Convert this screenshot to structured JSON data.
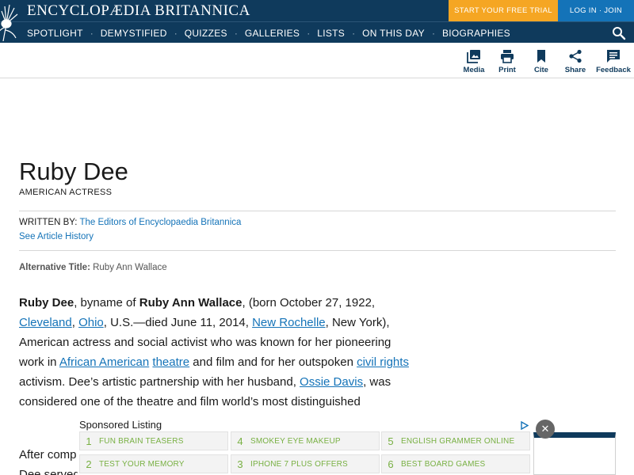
{
  "header": {
    "logo_text": "ENCYCLOPÆDIA BRITANNICA",
    "trial_button": "START YOUR FREE TRIAL",
    "login_button": "LOG IN · JOIN",
    "nav": [
      "SPOTLIGHT",
      "DEMYSTIFIED",
      "QUIZZES",
      "GALLERIES",
      "LISTS",
      "ON THIS DAY",
      "BIOGRAPHIES"
    ],
    "nav_separator": "·",
    "colors": {
      "navy": "#0f3a5c",
      "orange": "#f5a623",
      "blue": "#1473b8"
    }
  },
  "toolbar": {
    "media": "Media",
    "print": "Print",
    "cite": "Cite",
    "share": "Share",
    "feedback": "Feedback"
  },
  "article": {
    "title": "Ruby Dee",
    "subtitle": "AMERICAN ACTRESS",
    "written_by_label": "WRITTEN BY:",
    "author": "The Editors of Encyclopaedia Britannica",
    "history_link": "See Article History",
    "alt_title_label": "Alternative Title:",
    "alt_title_value": "Ruby Ann Wallace",
    "para1": {
      "name": "Ruby Dee",
      "t1": ", byname of ",
      "full_name": "Ruby Ann Wallace",
      "t2": ", (born October 27, 1922, ",
      "link_cleveland": "Cleveland",
      "t3": ", ",
      "link_ohio": "Ohio",
      "t4": ", U.S.—died June 11, 2014, ",
      "link_new_rochelle": "New Rochelle",
      "t5": ", New York), American actress and social activist who was known for her pioneering work in ",
      "link_african_american": "African American",
      "t6": " ",
      "link_theatre": "theatre",
      "t7": " and film and for her outspoken ",
      "link_civil_rights": "civil rights",
      "t8": " activism. Dee’s artistic partnership with her husband, ",
      "link_ossie_davis": "Ossie Davis",
      "t9": ", was considered one of the theatre and film world’s most distinguished"
    },
    "para2_line1": "After comp",
    "para2_line2": "Dee served"
  },
  "sponsored": {
    "title": "Sponsored Listing",
    "accent": "#78b043",
    "items": [
      {
        "num": "1",
        "label": "FUN BRAIN TEASERS"
      },
      {
        "num": "2",
        "label": "SMOKEY EYE MAKEUP"
      },
      {
        "num": "3",
        "label": "ENGLISH GRAMMER ONLINE"
      },
      {
        "num": "4",
        "label": "TEST YOUR MEMORY"
      },
      {
        "num": "5",
        "label": "IPHONE 7 PLUS OFFERS"
      },
      {
        "num": "6",
        "label": "BEST BOARD GAMES"
      }
    ],
    "close_symbol": "✕"
  }
}
